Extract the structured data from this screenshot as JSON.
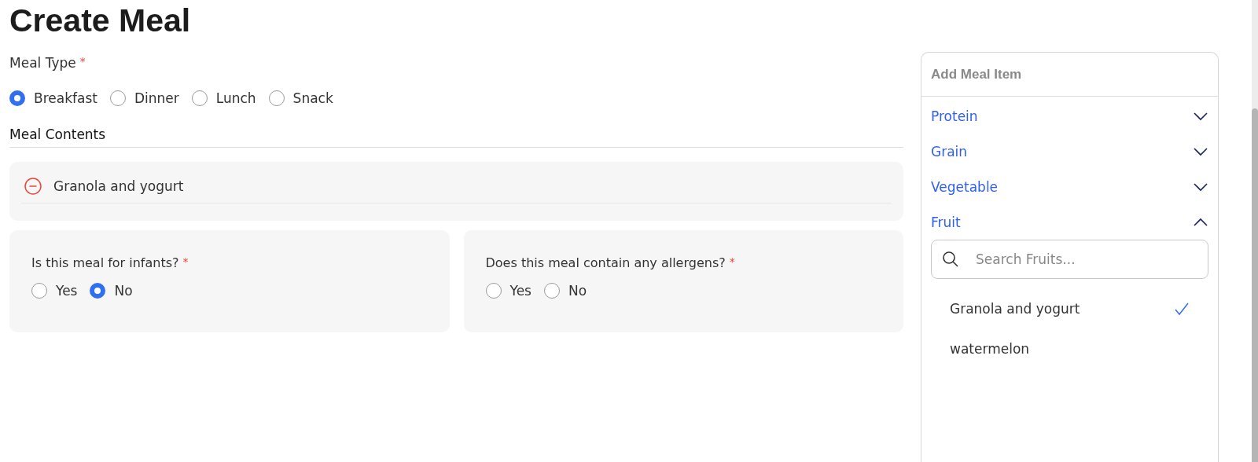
{
  "page_title": "Create Meal",
  "meal_type": {
    "label": "Meal Type",
    "required_mark": "*",
    "options": [
      {
        "label": "Breakfast",
        "selected": true
      },
      {
        "label": "Dinner",
        "selected": false
      },
      {
        "label": "Lunch",
        "selected": false
      },
      {
        "label": "Snack",
        "selected": false
      }
    ]
  },
  "meal_contents": {
    "heading": "Meal Contents",
    "items": [
      {
        "name": "Granola and yogurt"
      }
    ]
  },
  "questions": [
    {
      "label": "Is this meal for infants?",
      "required_mark": "*",
      "options": [
        {
          "label": "Yes",
          "selected": false
        },
        {
          "label": "No",
          "selected": true
        }
      ]
    },
    {
      "label": "Does this meal contain any allergens?",
      "required_mark": "*",
      "options": [
        {
          "label": "Yes",
          "selected": false
        },
        {
          "label": "No",
          "selected": false
        }
      ]
    }
  ],
  "add_meal_item": {
    "title": "Add Meal Item",
    "categories": [
      {
        "label": "Protein",
        "expanded": false
      },
      {
        "label": "Grain",
        "expanded": false
      },
      {
        "label": "Vegetable",
        "expanded": false
      },
      {
        "label": "Fruit",
        "expanded": true,
        "search": {
          "placeholder": "Search Fruits..."
        },
        "items": [
          {
            "label": "Granola and yogurt",
            "checked": true
          },
          {
            "label": "watermelon",
            "checked": false
          }
        ]
      }
    ]
  }
}
